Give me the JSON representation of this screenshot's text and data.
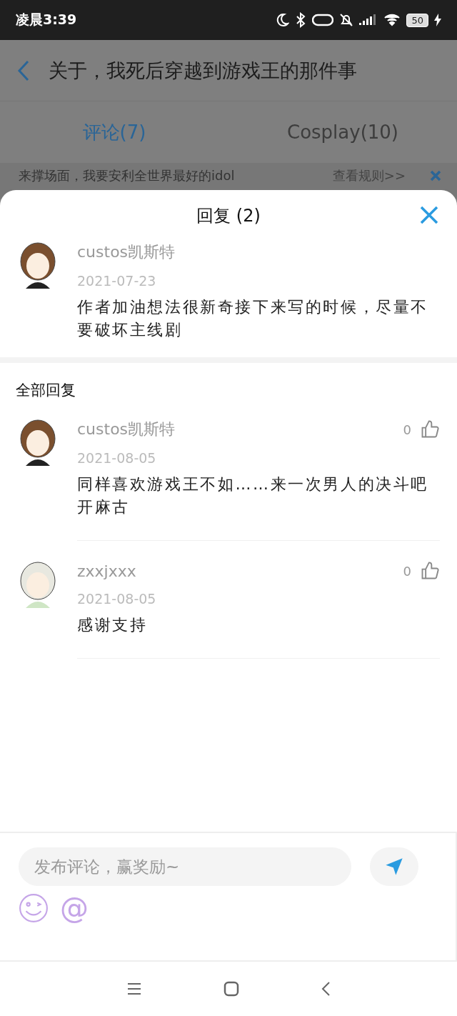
{
  "status_bar": {
    "time": "凌晨3:39",
    "battery": "50"
  },
  "header": {
    "title": "关于，我死后穿越到游戏王的那件事"
  },
  "tabs": [
    {
      "label": "评论(7)",
      "selected": true
    },
    {
      "label": "Cosplay(10)",
      "selected": false
    }
  ],
  "notice": {
    "text": "来撑场面，我要安利全世界最好的idol",
    "link": "查看规则>>"
  },
  "sheet": {
    "title": "回复 (2)",
    "comment": {
      "user": "custos凯斯特",
      "date": "2021-07-23",
      "text": "作者加油想法很新奇接下来写的时候，尽量不要破坏主线剧"
    },
    "section_title": "全部回复",
    "replies": [
      {
        "user": "custos凯斯特",
        "date": "2021-08-05",
        "text": "同样喜欢游戏王不如……来一次男人的决斗吧开麻古",
        "likes": "0"
      },
      {
        "user": "zxxjxxx",
        "date": "2021-08-05",
        "text": "感谢支持",
        "likes": "0"
      }
    ]
  },
  "composer": {
    "placeholder": "发布评论，赢奖励~",
    "mention": "@"
  }
}
